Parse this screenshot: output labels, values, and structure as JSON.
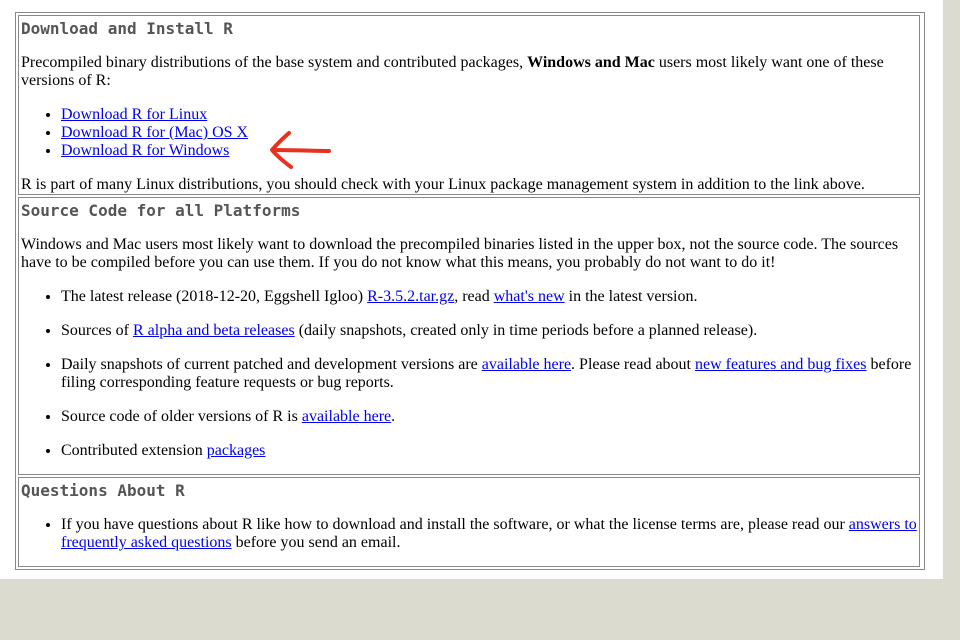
{
  "download": {
    "title": "Download and Install R",
    "intro_before": "Precompiled binary distributions of the base system and contributed packages, ",
    "intro_bold": "Windows and Mac",
    "intro_after": " users most likely want one of these versions of R:",
    "links": [
      "Download R for Linux",
      "Download R for (Mac) OS X",
      "Download R for Windows"
    ],
    "footer": "R is part of many Linux distributions, you should check with your Linux package management system in addition to the link above."
  },
  "source": {
    "title": "Source Code for all Platforms",
    "intro": "Windows and Mac users most likely want to download the precompiled binaries listed in the upper box, not the source code. The sources have to be compiled before you can use them. If you do not know what this means, you probably do not want to do it!",
    "item1": {
      "before": "The latest release (2018-12-20, Eggshell Igloo) ",
      "link1": "R-3.5.2.tar.gz",
      "mid": ", read ",
      "link2": "what's new",
      "after": " in the latest version."
    },
    "item2": {
      "before": "Sources of ",
      "link": "R alpha and beta releases",
      "after": " (daily snapshots, created only in time periods before a planned release)."
    },
    "item3": {
      "before": "Daily snapshots of current patched and development versions are ",
      "link1": "available here",
      "mid": ". Please read about ",
      "link2": "new features and bug fixes",
      "after": " before filing corresponding feature requests or bug reports."
    },
    "item4": {
      "before": "Source code of older versions of R is ",
      "link": "available here",
      "after": "."
    },
    "item5": {
      "before": "Contributed extension ",
      "link": "packages"
    }
  },
  "questions": {
    "title": "Questions About R",
    "item": {
      "before": "If you have questions about R like how to download and install the software, or what the license terms are, please read our ",
      "link": "answers to frequently asked questions",
      "after": " before you send an email."
    }
  },
  "annotation": {
    "icon": "red-arrow-icon",
    "color": "#e8321e"
  }
}
